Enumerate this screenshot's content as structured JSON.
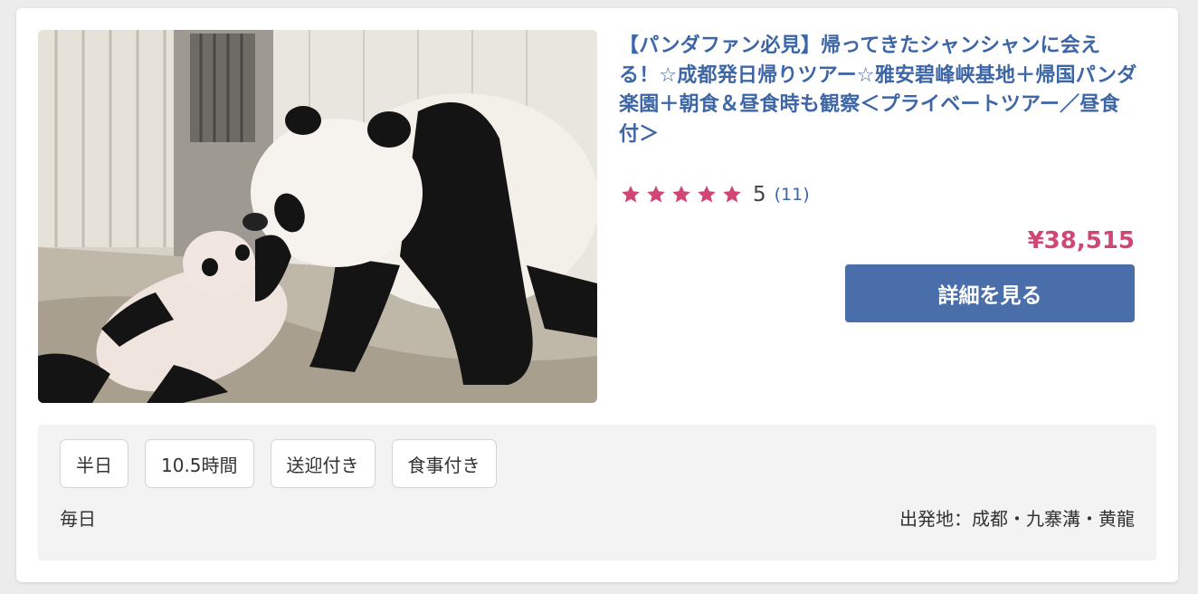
{
  "listing": {
    "image_alt": "パンダの親子",
    "title": "【パンダファン必見】帰ってきたシャンシャンに会える！☆成都発日帰りツアー☆雅安碧峰峡基地＋帰国パンダ楽園＋朝食＆昼食時も観察＜プライベートツアー／昼食付＞",
    "rating": {
      "stars": 5,
      "value": "5",
      "count": "(11)",
      "star_color": "#d14675"
    },
    "price": "¥38,515",
    "details_button": "詳細を見る",
    "tags": [
      "半日",
      "10.5時間",
      "送迎付き",
      "食事付き"
    ],
    "frequency": "毎日",
    "departure": "出発地：成都・九寨溝・黄龍"
  },
  "colors": {
    "title": "#3d66a6",
    "price": "#d14675",
    "button": "#4a6ea9"
  }
}
